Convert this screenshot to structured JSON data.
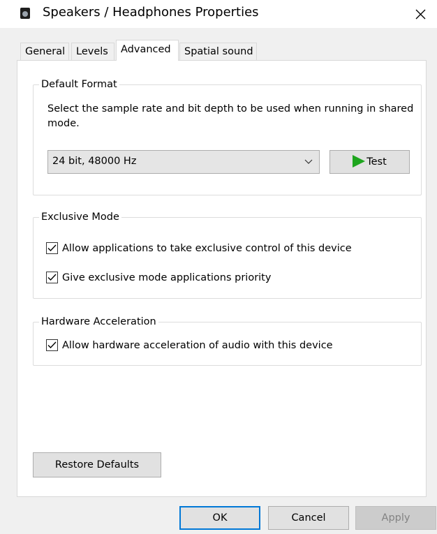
{
  "window": {
    "title": "Speakers / Headphones Properties"
  },
  "icons": {
    "app": "speaker-device-icon",
    "close": "close-icon",
    "dropdown": "chevron-down-icon",
    "play": "play-icon",
    "check": "checkmark-icon"
  },
  "tabs": [
    {
      "label": "General"
    },
    {
      "label": "Levels"
    },
    {
      "label": "Advanced",
      "active": true
    },
    {
      "label": "Spatial sound"
    }
  ],
  "default_format": {
    "legend": "Default Format",
    "description": "Select the sample rate and bit depth to be used when running in shared mode.",
    "selected": "24 bit, 48000 Hz",
    "test_label": "Test"
  },
  "exclusive_mode": {
    "legend": "Exclusive Mode",
    "allow_exclusive": {
      "label": "Allow applications to take exclusive control of this device",
      "checked": true
    },
    "priority": {
      "label": "Give exclusive mode applications priority",
      "checked": true
    }
  },
  "hardware_acceleration": {
    "legend": "Hardware Acceleration",
    "allow_hw": {
      "label": "Allow hardware acceleration of audio with this device",
      "checked": true
    }
  },
  "buttons": {
    "restore_defaults": "Restore Defaults",
    "ok": "OK",
    "cancel": "Cancel",
    "apply": "Apply"
  },
  "colors": {
    "accent": "#0078d7",
    "play": "#1ea51e",
    "dialog_bg": "#f0f0f0"
  }
}
